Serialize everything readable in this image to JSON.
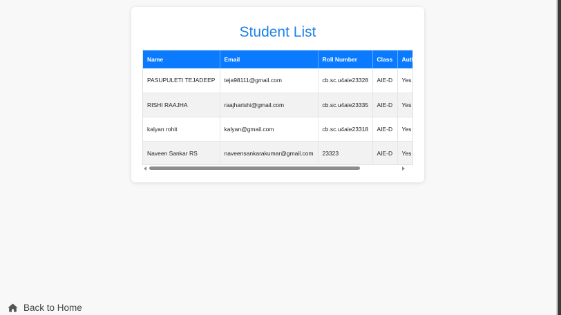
{
  "card": {
    "title": "Student List"
  },
  "table": {
    "headers": [
      "Name",
      "Email",
      "Roll Number",
      "Class",
      "Auth"
    ],
    "rows": [
      [
        "PASUPULETI TEJADEEP",
        "teja98111@gmail.com",
        "cb.sc.u4aie23328",
        "AIE-D",
        "Yes"
      ],
      [
        "RISHI RAAJHA",
        "raajharishi@gmail.com",
        "cb.sc.u4aie23335",
        "AIE-D",
        "Yes"
      ],
      [
        "kalyan rohit",
        "kalyan@gmail.com",
        "cb.sc.u4aie23318",
        "AIE-D",
        "Yes"
      ],
      [
        "Naveen Sankar RS",
        "naveensankarakumar@gmail.com",
        "23323",
        "AIE-D",
        "Yes"
      ]
    ]
  },
  "footer": {
    "back_label": "Back to Home",
    "back_icon": "home-icon"
  },
  "colors": {
    "header_bg": "#0a7bff",
    "title": "#1e82e6",
    "page_bg": "#f8f8f8"
  }
}
